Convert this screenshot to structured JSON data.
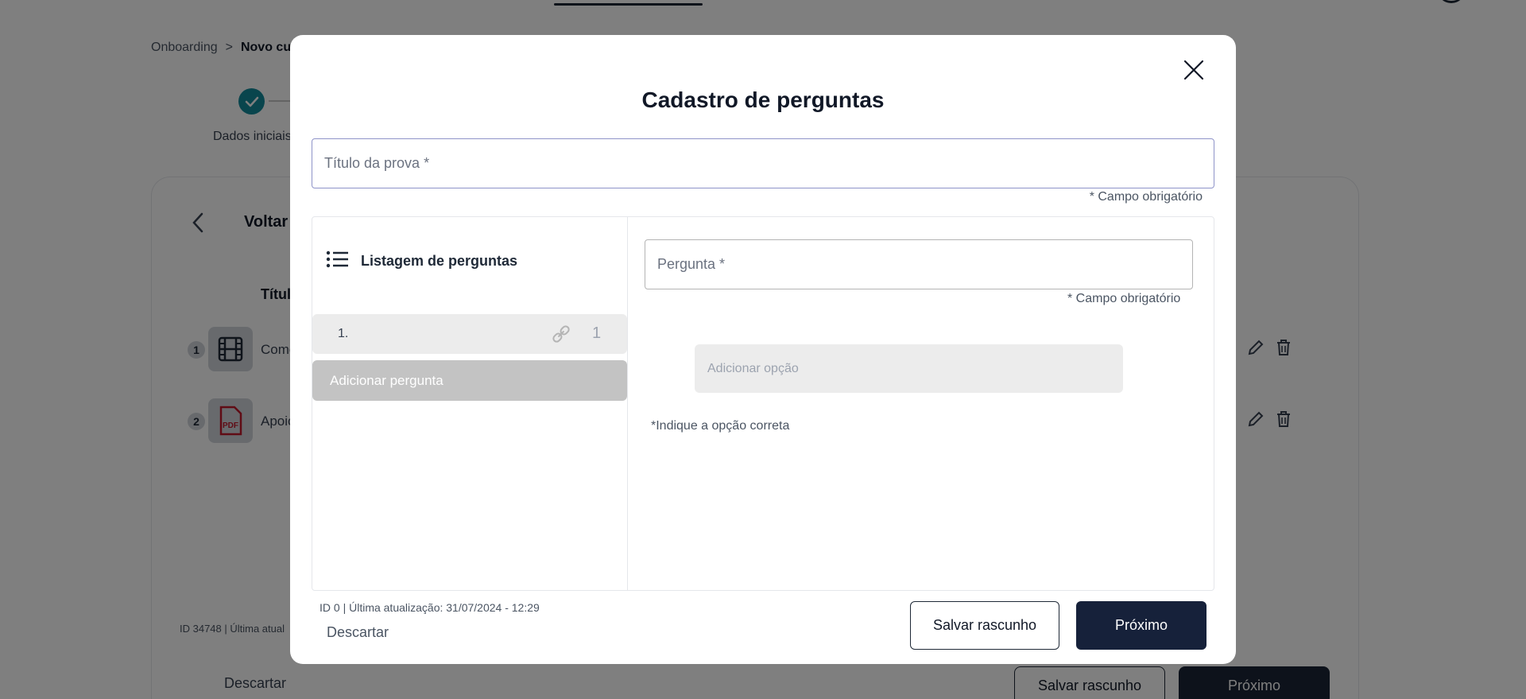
{
  "background": {
    "breadcrumb": {
      "root": "Onboarding",
      "separator": ">",
      "current": "Novo cu"
    },
    "stepper": {
      "step1_label": "Dados iniciais"
    },
    "back_label": "Voltar",
    "column_title": "Títul",
    "rows": [
      {
        "number": "1",
        "title": "Come",
        "thumb_icon": "film-icon"
      },
      {
        "number": "2",
        "title": "Apoio",
        "thumb_icon": "pdf-icon"
      }
    ],
    "footer_id": "ID 34748 | Última atual",
    "discard_label": "Descartar",
    "save_draft_label": "Salvar rascunho",
    "next_label": "Próximo"
  },
  "modal": {
    "title": "Cadastro de perguntas",
    "exam_title_placeholder": "Título da prova *",
    "exam_title_value": "",
    "required_note": "* Campo obrigatório",
    "list_header": "Listagem de perguntas",
    "questions": [
      {
        "number": "1.",
        "count": "1"
      }
    ],
    "add_question_label": "Adicionar pergunta",
    "question_placeholder": "Pergunta *",
    "question_value": "",
    "question_required_note": "* Campo obrigatório",
    "add_option_label": "Adicionar opção",
    "correct_option_hint": "*Indique a opção correta",
    "meta": "ID 0 | Última atualização: 31/07/2024 - 12:29",
    "discard_label": "Descartar",
    "save_draft_label": "Salvar rascunho",
    "next_label": "Próximo"
  },
  "colors": {
    "primary_dark": "#16213a",
    "accent_teal": "#138a9a",
    "overlay": "rgba(0,0,0,0.5)"
  }
}
